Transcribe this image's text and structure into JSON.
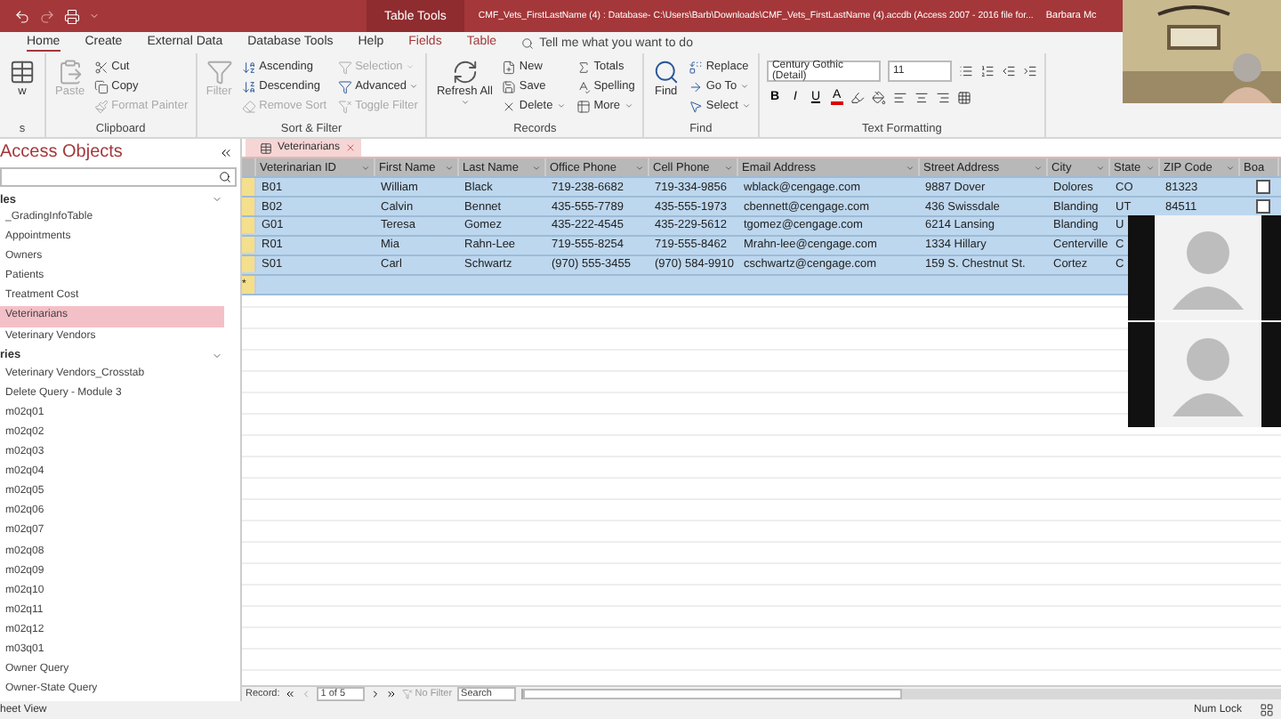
{
  "title_bar": {
    "context_tab": "Table Tools",
    "title": "CMF_Vets_FirstLastName (4) : Database- C:\\Users\\Barb\\Downloads\\CMF_Vets_FirstLastName (4).accdb (Access 2007 - 2016 file for...",
    "user": "Barbara Mc"
  },
  "ribbon_tabs": [
    {
      "label": "Home",
      "selected": true,
      "kind": "main"
    },
    {
      "label": "Create",
      "selected": false,
      "kind": "main"
    },
    {
      "label": "External Data",
      "selected": false,
      "kind": "main"
    },
    {
      "label": "Database Tools",
      "selected": false,
      "kind": "main"
    },
    {
      "label": "Help",
      "selected": false,
      "kind": "main"
    },
    {
      "label": "Fields",
      "selected": false,
      "kind": "context"
    },
    {
      "label": "Table",
      "selected": false,
      "kind": "context"
    }
  ],
  "tell_me": {
    "placeholder": "Tell me what you want to do"
  },
  "ribbon_groups": [
    {
      "label": "s",
      "items": [
        {
          "label": "w",
          "kind": "large",
          "disabled": false
        }
      ]
    },
    {
      "label": "Clipboard",
      "items": [
        {
          "label": "Paste",
          "kind": "large",
          "disabled": true
        },
        {
          "label": "Cut",
          "kind": "small",
          "disabled": false
        },
        {
          "label": "Copy",
          "kind": "small",
          "disabled": false
        },
        {
          "label": "Format Painter",
          "kind": "small",
          "disabled": true
        }
      ]
    },
    {
      "label": "Sort & Filter",
      "items": [
        {
          "label": "Filter",
          "kind": "large",
          "disabled": true
        },
        {
          "label": "Ascending",
          "kind": "small",
          "disabled": false
        },
        {
          "label": "Descending",
          "kind": "small",
          "disabled": false
        },
        {
          "label": "Remove Sort",
          "kind": "small",
          "disabled": true
        },
        {
          "label": "Selection",
          "kind": "small",
          "disabled": true,
          "dropdown": true
        },
        {
          "label": "Advanced",
          "kind": "small",
          "disabled": false,
          "dropdown": true
        },
        {
          "label": "Toggle Filter",
          "kind": "small",
          "disabled": true
        }
      ]
    },
    {
      "label": "Records",
      "items": [
        {
          "label": "Refresh All",
          "kind": "large",
          "disabled": false,
          "dropdown": true
        },
        {
          "label": "New",
          "kind": "small",
          "disabled": false
        },
        {
          "label": "Save",
          "kind": "small",
          "disabled": false
        },
        {
          "label": "Delete",
          "kind": "small",
          "disabled": false,
          "dropdown": true
        },
        {
          "label": "Totals",
          "kind": "small",
          "disabled": false
        },
        {
          "label": "Spelling",
          "kind": "small",
          "disabled": false
        },
        {
          "label": "More",
          "kind": "small",
          "disabled": false,
          "dropdown": true
        }
      ]
    },
    {
      "label": "Find",
      "items": [
        {
          "label": "Find",
          "kind": "large",
          "disabled": false
        },
        {
          "label": "Replace",
          "kind": "small",
          "disabled": false
        },
        {
          "label": "Go To",
          "kind": "small",
          "disabled": false,
          "dropdown": true
        },
        {
          "label": "Select",
          "kind": "small",
          "disabled": false,
          "dropdown": true
        }
      ]
    }
  ],
  "text_formatting": {
    "label": "Text Formatting",
    "font": "Century Gothic (Detail)",
    "size": "11",
    "styles": [
      "B",
      "I",
      "U"
    ],
    "font_color": "A"
  },
  "nav_pane": {
    "title": "Access Objects",
    "sections": [
      {
        "label": "les",
        "items": [
          {
            "label": "_GradingInfoTable",
            "selected": false
          },
          {
            "label": "Appointments",
            "selected": false
          },
          {
            "label": "Owners",
            "selected": false
          },
          {
            "label": "Patients",
            "selected": false
          },
          {
            "label": "Treatment Cost",
            "selected": false
          },
          {
            "label": "Veterinarians",
            "selected": true
          },
          {
            "label": "Veterinary Vendors",
            "selected": false
          }
        ]
      },
      {
        "label": "ries",
        "items": [
          {
            "label": "Veterinary Vendors_Crosstab",
            "selected": false
          },
          {
            "label": "Delete Query - Module 3",
            "selected": false
          },
          {
            "label": "m02q01",
            "selected": false
          },
          {
            "label": "m02q02",
            "selected": false
          },
          {
            "label": "m02q03",
            "selected": false
          },
          {
            "label": "m02q04",
            "selected": false
          },
          {
            "label": "m02q05",
            "selected": false
          },
          {
            "label": "m02q06",
            "selected": false
          },
          {
            "label": "m02q07",
            "selected": false
          },
          {
            "label": "m02q08",
            "selected": false
          },
          {
            "label": "m02q09",
            "selected": false
          },
          {
            "label": "m02q10",
            "selected": false
          },
          {
            "label": "m02q11",
            "selected": false
          },
          {
            "label": "m02q12",
            "selected": false
          },
          {
            "label": "m03q01",
            "selected": false
          },
          {
            "label": "Owner Query",
            "selected": false
          },
          {
            "label": "Owner-State Query",
            "selected": false
          }
        ]
      }
    ]
  },
  "document_tab": {
    "label": "Veterinarians"
  },
  "table": {
    "columns": [
      "Veterinarian ID",
      "First Name",
      "Last Name",
      "Office Phone",
      "Cell Phone",
      "Email Address",
      "Street Address",
      "City",
      "State",
      "ZIP Code",
      "Boa"
    ],
    "rows": [
      {
        "selected": true,
        "cells": [
          "B01",
          "William",
          "Black",
          "719-238-6682",
          "719-334-9856",
          "wblack@cengage.com",
          "9887 Dover",
          "Dolores",
          "CO",
          "81323"
        ],
        "checked": false
      },
      {
        "selected": true,
        "cells": [
          "B02",
          "Calvin",
          "Bennet",
          "435-555-7789",
          "435-555-1973",
          "cbennett@cengage.com",
          "436 Swissdale",
          "Blanding",
          "UT",
          "84511"
        ],
        "checked": false
      },
      {
        "selected": true,
        "cells": [
          "G01",
          "Teresa",
          "Gomez",
          "435-222-4545",
          "435-229-5612",
          "tgomez@cengage.com",
          "6214 Lansing",
          "Blanding",
          "U"
        ]
      },
      {
        "selected": true,
        "cells": [
          "R01",
          "Mia",
          "Rahn-Lee",
          "719-555-8254",
          "719-555-8462",
          "Mrahn-lee@cengage.com",
          "1334 Hillary",
          "Centerville",
          "C"
        ]
      },
      {
        "selected": true,
        "cells": [
          "S01",
          "Carl",
          "Schwartz",
          "(970) 555-3455",
          "(970) 584-9910",
          "cschwartz@cengage.com",
          "159 S. Chestnut St.",
          "Cortez",
          "C"
        ]
      }
    ],
    "new_row_marker": "*"
  },
  "record_nav": {
    "label": "Record:",
    "position": "1 of 5",
    "filter": "No Filter",
    "search": "Search"
  },
  "status_bar": {
    "view": "heet View",
    "num_lock": "Num Lock"
  },
  "overlays": [
    {
      "kind": "picture"
    },
    {
      "kind": "avatar"
    },
    {
      "kind": "avatar"
    }
  ]
}
